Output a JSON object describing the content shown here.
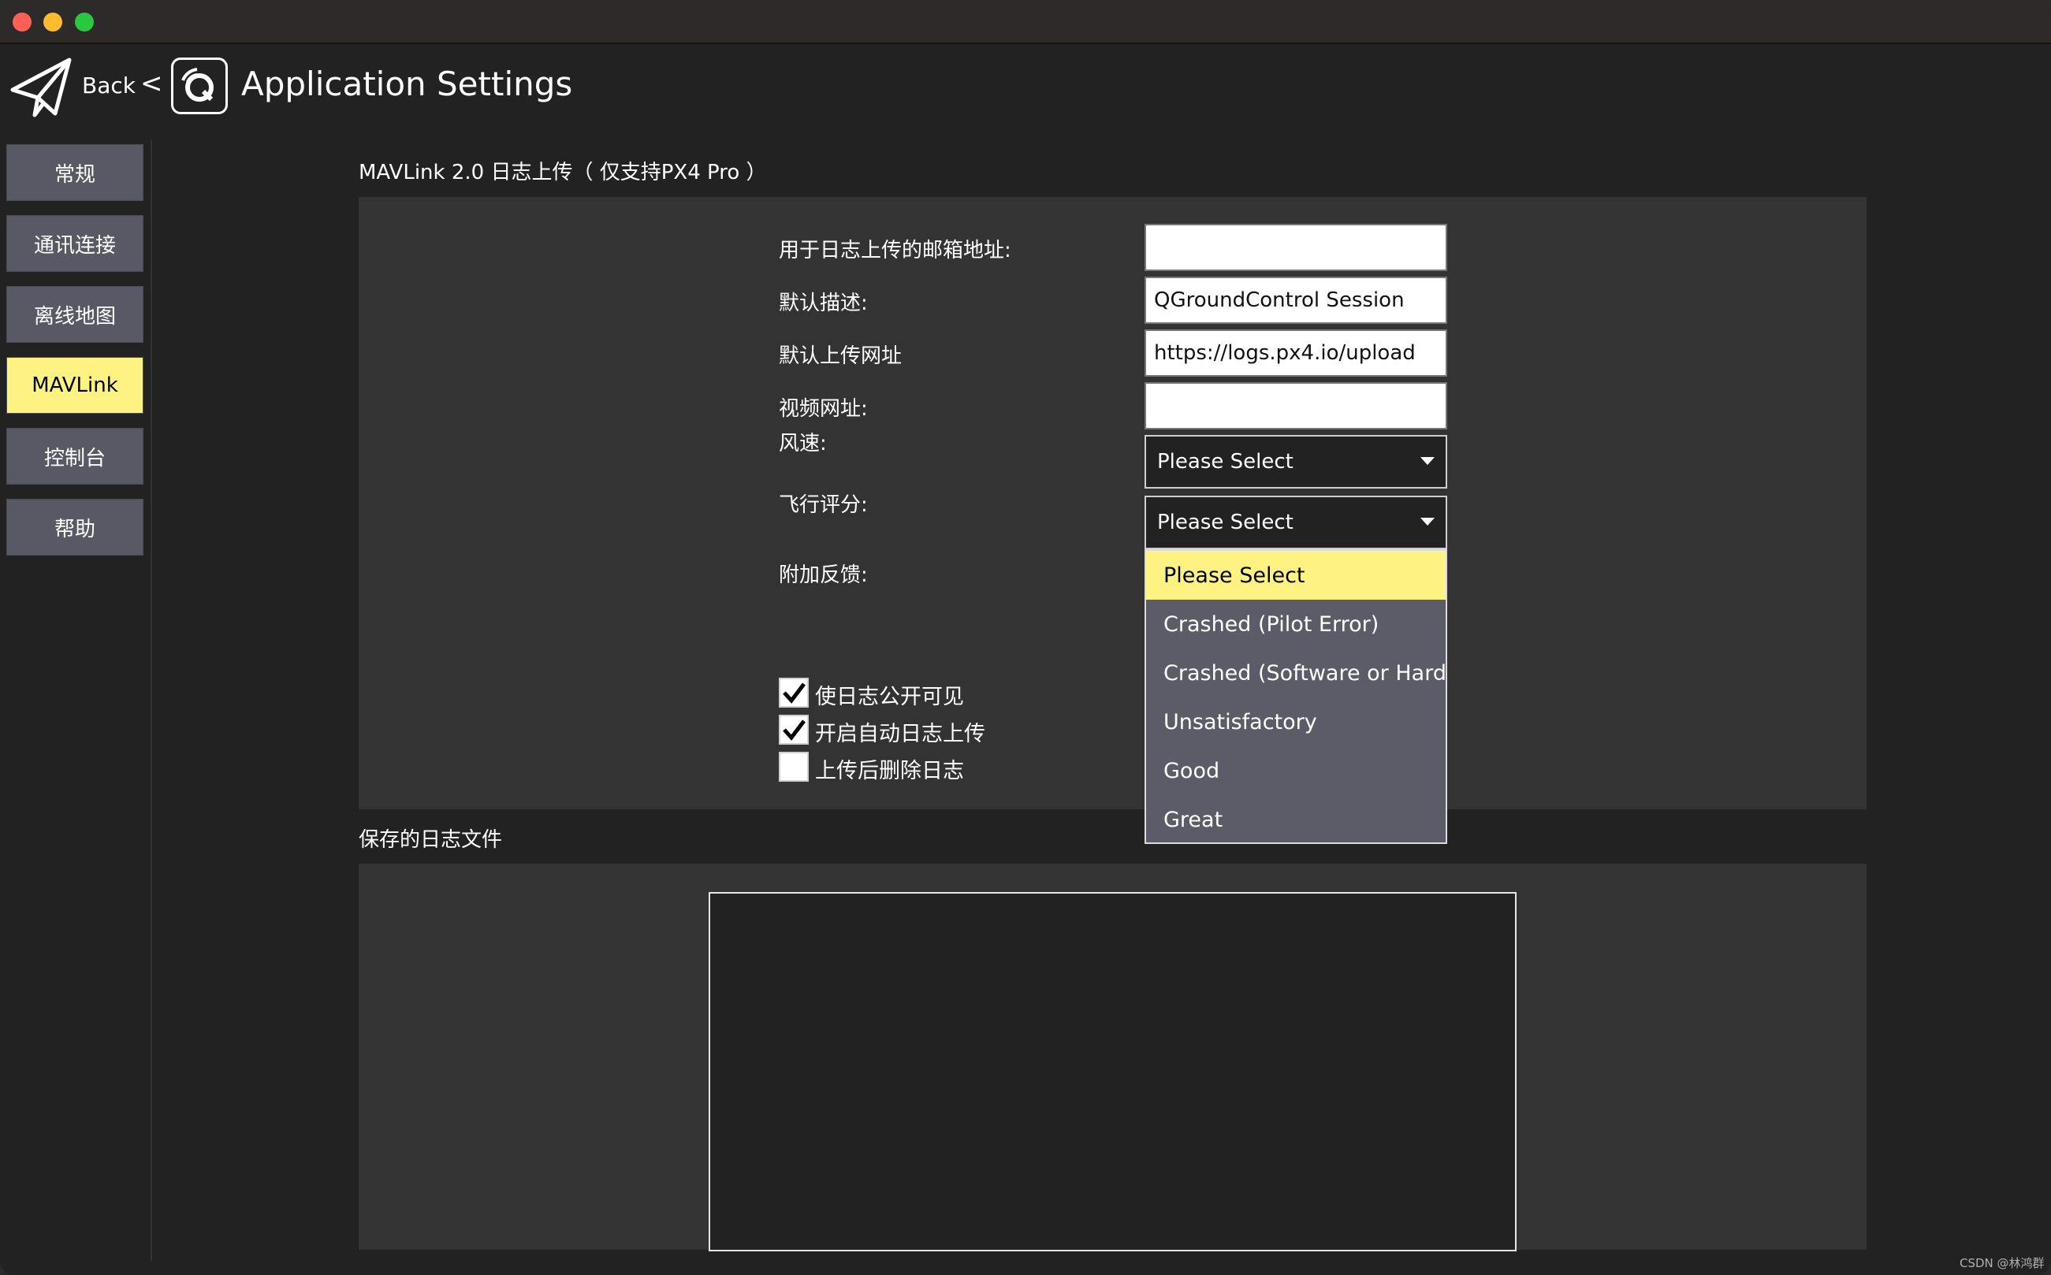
{
  "window": {
    "traffic_lights": {
      "close": "#ff5f57",
      "minimize": "#febc2e",
      "maximize": "#28c840"
    }
  },
  "toolbar": {
    "back_label": "Back",
    "separator": "<",
    "title": "Application Settings",
    "logo_icon": "paper-plane-icon",
    "app_icon": "qgc-logo-icon"
  },
  "sidebar": {
    "items": [
      {
        "label": "常规",
        "active": false
      },
      {
        "label": "通讯连接",
        "active": false
      },
      {
        "label": "离线地图",
        "active": false
      },
      {
        "label": "MAVLink",
        "active": true
      },
      {
        "label": "控制台",
        "active": false
      },
      {
        "label": "帮助",
        "active": false
      }
    ]
  },
  "upload_section": {
    "title": "MAVLink 2.0 日志上传（ 仅支持PX4 Pro ）",
    "email_label": "用于日志上传的邮箱地址:",
    "email_value": "",
    "description_label": "默认描述:",
    "description_value": "QGroundControl Session",
    "url_label": "默认上传网址",
    "url_value": "https://logs.px4.io/upload",
    "video_label": "视频网址:",
    "video_value": "",
    "wind_label": "风速:",
    "wind_value": "Please Select",
    "rating_label": "飞行评分:",
    "rating_value": "Please Select",
    "feedback_label": "附加反馈:",
    "rating_options": [
      "Please Select",
      "Crashed (Pilot Error)",
      "Crashed (Software or Hardwa",
      "Unsatisfactory",
      "Good",
      "Great"
    ],
    "checkboxes": [
      {
        "label": "使日志公开可见",
        "checked": true
      },
      {
        "label": "开启自动日志上传",
        "checked": true
      },
      {
        "label": "上传后删除日志",
        "checked": false
      }
    ]
  },
  "saved_logs": {
    "title": "保存的日志文件"
  },
  "watermark": "CSDN @林鸿群",
  "colors": {
    "accent": "#fef283",
    "sidebar_button": "#585965",
    "panel": "#333333",
    "background": "#222222"
  }
}
